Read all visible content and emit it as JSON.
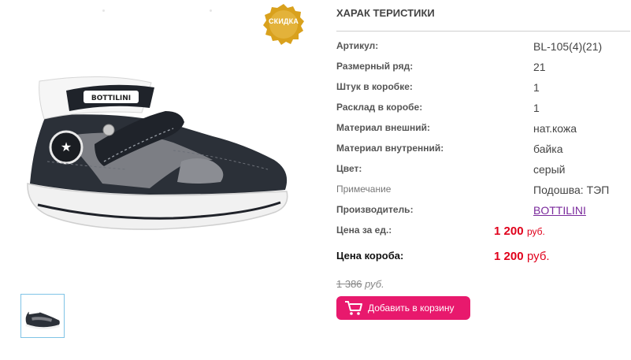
{
  "badge": {
    "label": "СКИДКА"
  },
  "product": {
    "brand_on_shoe": "BOTTILINI"
  },
  "specs": {
    "title": "ХАРАК ТЕРИСТИКИ",
    "rows": [
      {
        "label": "Артикул:",
        "value": "BL-105(4)(21)"
      },
      {
        "label": "Размерный ряд:",
        "value": "21"
      },
      {
        "label": "Штук в коробке:",
        "value": "1"
      },
      {
        "label": "Расклад в коробе:",
        "value": "1"
      },
      {
        "label": "Материал внешний:",
        "value": "нат.кожа"
      },
      {
        "label": "Материал внутренний:",
        "value": "байка"
      },
      {
        "label": "Цвет:",
        "value": "серый"
      },
      {
        "label": "Примечание",
        "value": "Подошва: ТЭП"
      },
      {
        "label": "Производитель:",
        "value": "BOTTILINI"
      }
    ]
  },
  "price": {
    "unit_label": "Цена за ед.:",
    "unit_value": "1 200",
    "unit_currency": "руб.",
    "box_label": "Цена короба:",
    "box_value": "1 200",
    "box_currency": "руб.",
    "old_value": "1 386",
    "old_currency": "руб."
  },
  "cart": {
    "add_label": "Добавить в корзину",
    "icon": "cart-icon"
  },
  "colors": {
    "accent": "#e8196d",
    "price": "#e0001b",
    "link": "#7a2a9c",
    "badge": "#d9a11d"
  }
}
